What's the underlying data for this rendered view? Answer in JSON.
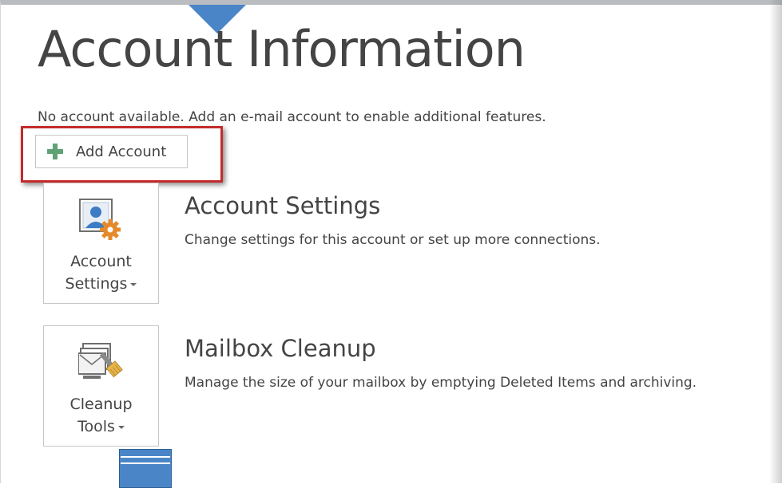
{
  "page": {
    "title": "Account Information",
    "notice": "No account available. Add an e-mail account to enable additional features."
  },
  "add_account": {
    "label": "Add Account",
    "icon": "plus-icon",
    "highlight_color": "#c42b2b"
  },
  "account_settings": {
    "tile_label_line1": "Account",
    "tile_label_line2": "Settings",
    "icon": "account-settings-icon",
    "heading": "Account Settings",
    "description": "Change settings for this account or set up more connections."
  },
  "mailbox_cleanup": {
    "tile_label_line1": "Cleanup",
    "tile_label_line2": "Tools",
    "icon": "cleanup-tools-icon",
    "heading": "Mailbox Cleanup",
    "description": "Manage the size of your mailbox by emptying Deleted Items and archiving."
  },
  "colors": {
    "text": "#444444",
    "accent_blue": "#4a86c7",
    "plus_green": "#5fa374",
    "gear_orange": "#e58a2c"
  }
}
